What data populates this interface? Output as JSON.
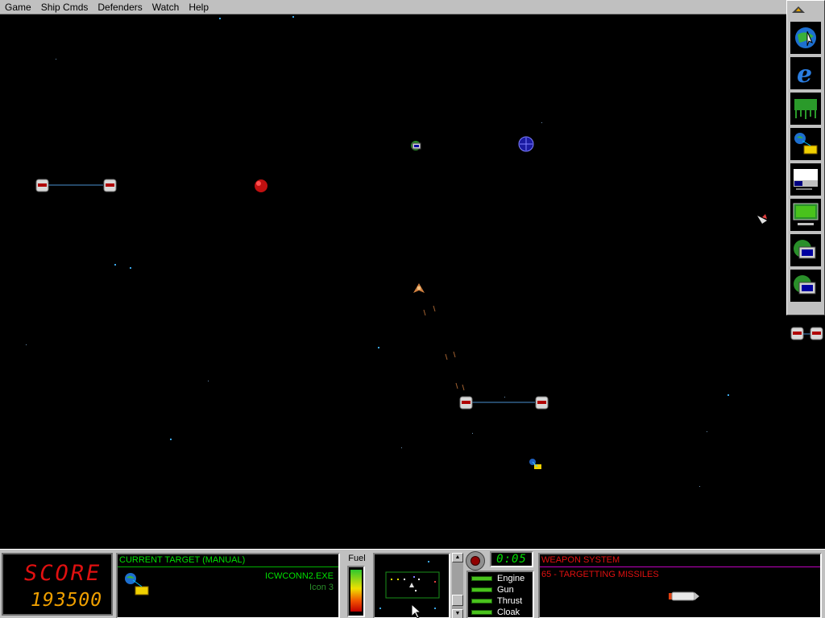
{
  "menu": {
    "items": [
      "Game",
      "Ship Cmds",
      "Defenders",
      "Watch",
      "Help"
    ]
  },
  "iconbar": {
    "tools": [
      "globe-cursor-icon",
      "internet-explorer-icon",
      "network-neighborhood-icon",
      "dialup-network-icon",
      "taskbar-icon",
      "display-properties-icon",
      "network-computer-icon",
      "network-computer-2-icon"
    ]
  },
  "score": {
    "label": "SCORE",
    "value": "193500"
  },
  "target": {
    "header": "CURRENT TARGET  (MANUAL)",
    "name": "ICWCONN2.EXE",
    "icon_label": "Icon 3"
  },
  "fuel": {
    "label": "Fuel",
    "level": 0.92
  },
  "timer": {
    "value": "0:05"
  },
  "status": {
    "items": [
      "Engine",
      "Gun",
      "Thrust",
      "Cloak"
    ]
  },
  "weapon": {
    "header": "WEAPON SYSTEM",
    "selected": "65 - TARGETTING MISSILES"
  },
  "colors": {
    "accent_red": "#e01010",
    "accent_green": "#00e000",
    "star_blue": "#3aa6e8",
    "segment_orange": "#f0a000"
  }
}
